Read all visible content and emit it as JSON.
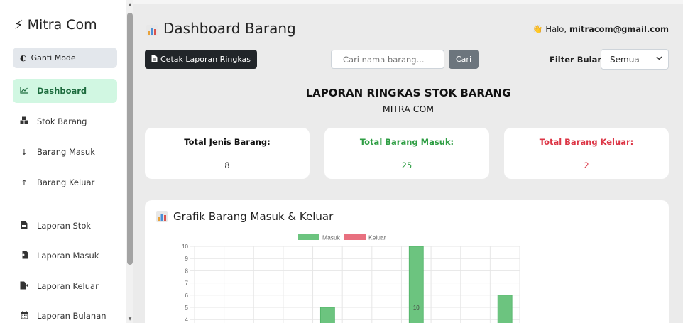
{
  "sidebar": {
    "brand": "Mitra Com",
    "mode_button": "Ganti Mode",
    "items": [
      {
        "label": "Dashboard",
        "icon": "chart-line-icon"
      },
      {
        "label": "Stok Barang",
        "icon": "boxes-icon"
      },
      {
        "label": "Barang Masuk",
        "icon": "arrow-down-icon"
      },
      {
        "label": "Barang Keluar",
        "icon": "arrow-up-icon"
      },
      {
        "label": "Laporan Stok",
        "icon": "file-icon"
      },
      {
        "label": "Laporan Masuk",
        "icon": "file-import-icon"
      },
      {
        "label": "Laporan Keluar",
        "icon": "file-export-icon"
      },
      {
        "label": "Laporan Bulanan",
        "icon": "calendar-icon"
      }
    ]
  },
  "header": {
    "title": "Dashboard Barang",
    "greeting_prefix": "Halo,",
    "user_email": "mitracom@gmail.com"
  },
  "toolbar": {
    "print_label": "Cetak Laporan Ringkas",
    "search_placeholder": "Cari nama barang...",
    "search_button": "Cari",
    "filter_label": "Filter Bulan:",
    "filter_value": "Semua"
  },
  "report": {
    "title": "LAPORAN RINGKAS STOK BARANG",
    "subtitle": "MITRA COM"
  },
  "stats": {
    "total_jenis_label": "Total Jenis Barang:",
    "total_jenis_value": "8",
    "total_masuk_label": "Total Barang Masuk:",
    "total_masuk_value": "25",
    "total_keluar_label": "Total Barang Keluar:",
    "total_keluar_value": "2"
  },
  "colors": {
    "active_nav_bg": "#d1f7e2",
    "masuk": "#6cc47f",
    "keluar": "#e8707f",
    "masuk_text": "#2f9e44",
    "keluar_text": "#dc3545"
  },
  "chart_data": {
    "type": "bar",
    "title": "Grafik Barang Masuk & Keluar",
    "series": [
      {
        "name": "Masuk",
        "values": [
          0,
          0,
          0,
          0,
          5,
          0,
          0,
          10,
          0,
          0,
          6
        ]
      },
      {
        "name": "Keluar",
        "values": [
          0,
          0,
          0,
          0,
          0,
          0,
          0,
          0,
          0,
          0,
          0
        ]
      }
    ],
    "ylim": [
      0,
      10
    ],
    "yticks": [
      "10",
      "9",
      "8",
      "7",
      "6",
      "5",
      "4"
    ],
    "data_label": "10",
    "grid": true,
    "legend_position": "top"
  }
}
